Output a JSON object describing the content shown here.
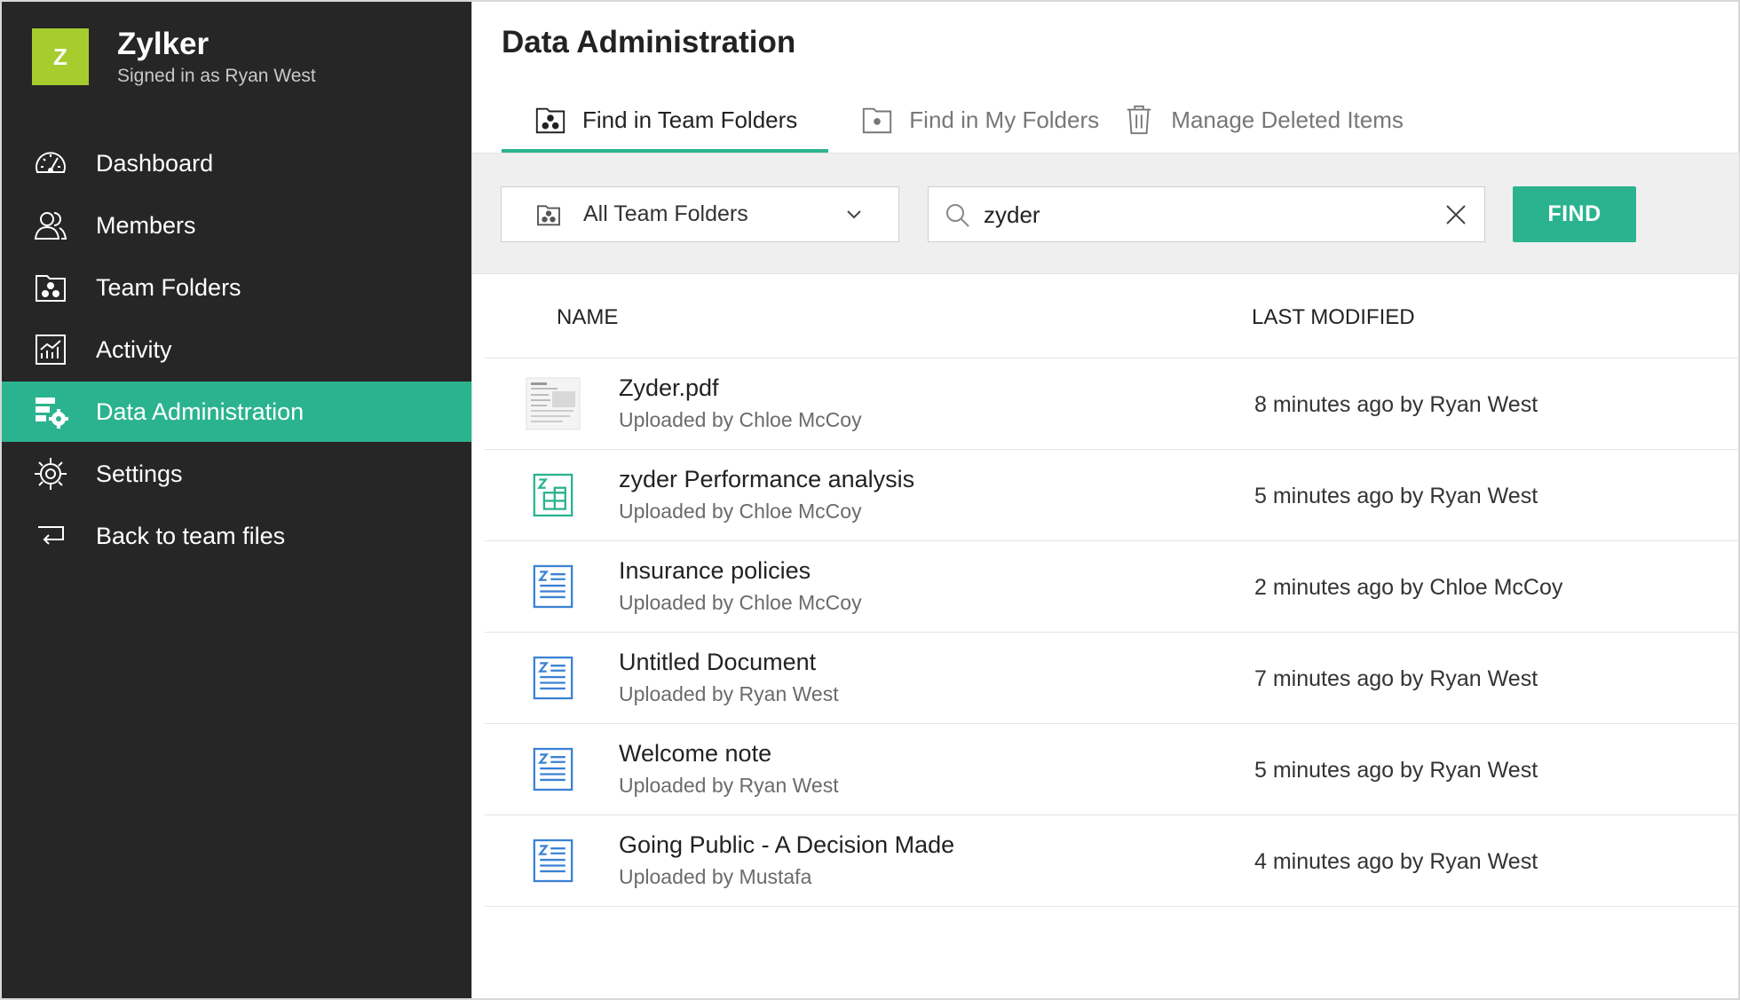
{
  "brand": {
    "logo_letter": "Z",
    "name": "Zylker",
    "signed_in": "Signed in as Ryan West",
    "accent": "#a6cc2e"
  },
  "sidebar": {
    "items": [
      {
        "label": "Dashboard",
        "icon": "dashboard-gauge-icon",
        "active": false
      },
      {
        "label": "Members",
        "icon": "members-icon",
        "active": false
      },
      {
        "label": "Team Folders",
        "icon": "team-folder-icon",
        "active": false
      },
      {
        "label": "Activity",
        "icon": "activity-chart-icon",
        "active": false
      },
      {
        "label": "Data Administration",
        "icon": "data-admin-icon",
        "active": true
      },
      {
        "label": "Settings",
        "icon": "settings-gear-icon",
        "active": false
      },
      {
        "label": "Back to team files",
        "icon": "back-arrow-icon",
        "active": false
      }
    ],
    "active_color": "#2bb38f"
  },
  "main": {
    "title": "Data Administration",
    "tabs": [
      {
        "label": "Find in Team Folders",
        "icon": "team-folder-icon",
        "active": true
      },
      {
        "label": "Find in My Folders",
        "icon": "my-folder-icon",
        "active": false
      },
      {
        "label": "Manage Deleted Items",
        "icon": "trash-icon",
        "active": false
      }
    ]
  },
  "toolbar": {
    "folder_select_value": "All Team Folders",
    "search_value": "zyder",
    "find_label": "FIND"
  },
  "table": {
    "columns": [
      "NAME",
      "LAST MODIFIED"
    ],
    "rows": [
      {
        "title": "Zyder.pdf",
        "sub": "Uploaded by Chloe McCoy",
        "modified": "8 minutes ago by Ryan West",
        "icon": "pdf-thumbnail-icon"
      },
      {
        "title": "zyder Performance analysis",
        "sub": "Uploaded by Chloe McCoy",
        "modified": "5 minutes ago by Ryan West",
        "icon": "spreadsheet-icon"
      },
      {
        "title": "Insurance policies",
        "sub": "Uploaded by Chloe McCoy",
        "modified": "2 minutes ago by Chloe McCoy",
        "icon": "document-icon"
      },
      {
        "title": "Untitled Document",
        "sub": "Uploaded by Ryan West",
        "modified": "7 minutes ago by Ryan West",
        "icon": "document-icon"
      },
      {
        "title": "Welcome note",
        "sub": "Uploaded by Ryan West",
        "modified": "5 minutes ago by Ryan West",
        "icon": "document-icon"
      },
      {
        "title": "Going Public - A Decision Made",
        "sub": "Uploaded by Mustafa",
        "modified": "4 minutes ago by Ryan West",
        "icon": "document-icon"
      }
    ]
  }
}
